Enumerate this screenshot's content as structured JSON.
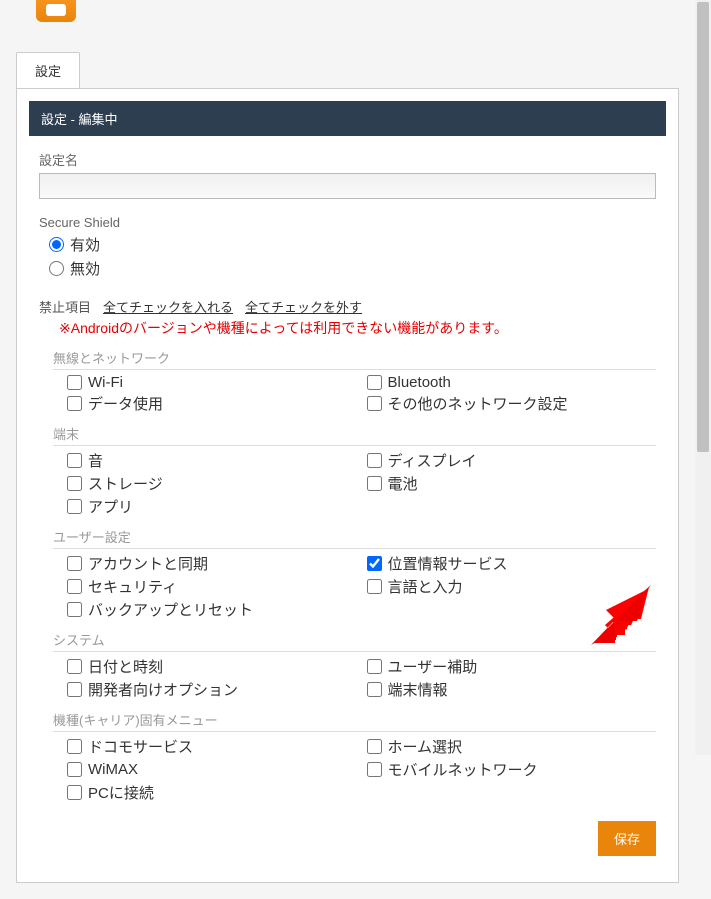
{
  "tab": {
    "label": "設定"
  },
  "panel": {
    "title": "設定 - 編集中"
  },
  "form": {
    "nameLabel": "設定名",
    "nameValue": "",
    "shieldLabel": "Secure Shield",
    "shieldOptions": {
      "enabled": "有効",
      "disabled": "無効"
    },
    "prohibitLabel": "禁止項目",
    "checkAll": "全てチェックを入れる",
    "uncheckAll": "全てチェックを外す",
    "warning": "※Androidのバージョンや機種によっては利用できない機能があります。"
  },
  "groups": [
    {
      "title": "無線とネットワーク",
      "items": [
        {
          "label": "Wi-Fi",
          "checked": false
        },
        {
          "label": "Bluetooth",
          "checked": false
        },
        {
          "label": "データ使用",
          "checked": false
        },
        {
          "label": "その他のネットワーク設定",
          "checked": false
        }
      ]
    },
    {
      "title": "端末",
      "items": [
        {
          "label": "音",
          "checked": false
        },
        {
          "label": "ディスプレイ",
          "checked": false
        },
        {
          "label": "ストレージ",
          "checked": false
        },
        {
          "label": "電池",
          "checked": false
        },
        {
          "label": "アプリ",
          "checked": false
        }
      ]
    },
    {
      "title": "ユーザー設定",
      "items": [
        {
          "label": "アカウントと同期",
          "checked": false
        },
        {
          "label": "位置情報サービス",
          "checked": true
        },
        {
          "label": "セキュリティ",
          "checked": false
        },
        {
          "label": "言語と入力",
          "checked": false
        },
        {
          "label": "バックアップとリセット",
          "checked": false
        }
      ]
    },
    {
      "title": "システム",
      "items": [
        {
          "label": "日付と時刻",
          "checked": false
        },
        {
          "label": "ユーザー補助",
          "checked": false
        },
        {
          "label": "開発者向けオプション",
          "checked": false
        },
        {
          "label": "端末情報",
          "checked": false
        }
      ]
    },
    {
      "title": "機種(キャリア)固有メニュー",
      "items": [
        {
          "label": "ドコモサービス",
          "checked": false
        },
        {
          "label": "ホーム選択",
          "checked": false
        },
        {
          "label": "WiMAX",
          "checked": false
        },
        {
          "label": "モバイルネットワーク",
          "checked": false
        },
        {
          "label": "PCに接続",
          "checked": false
        }
      ]
    }
  ],
  "footer": {
    "save": "保存"
  }
}
